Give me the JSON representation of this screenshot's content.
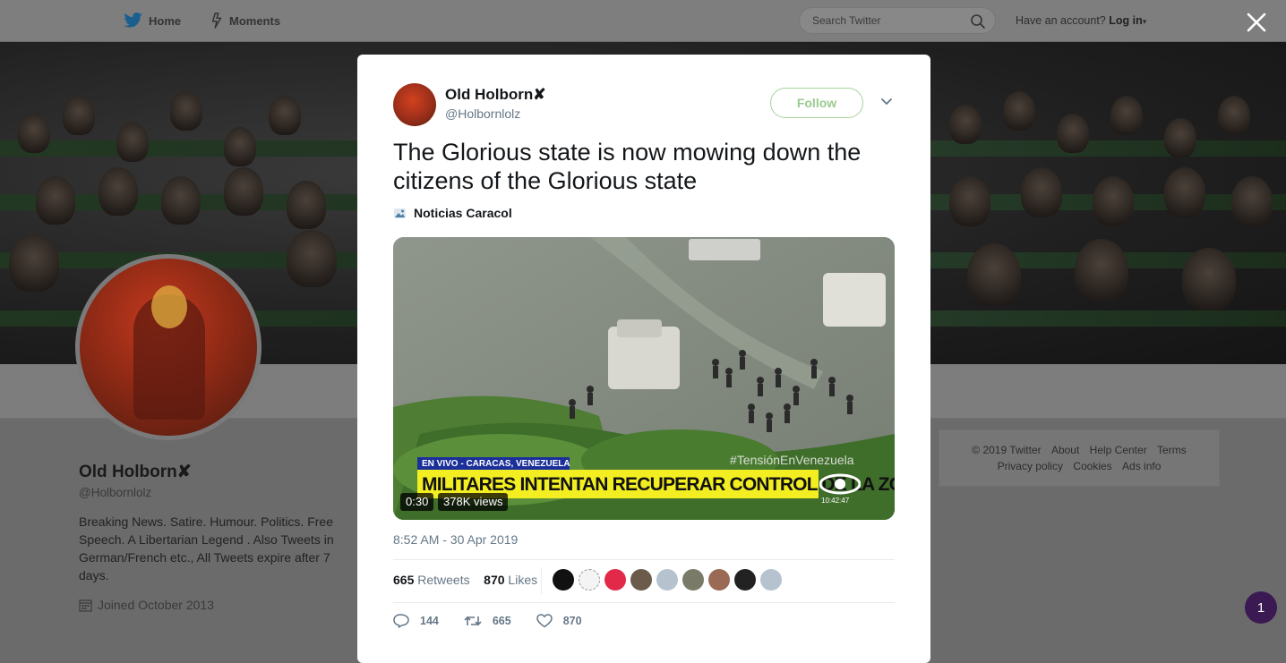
{
  "nav": {
    "home_label": "Home",
    "moments_label": "Moments",
    "search_placeholder": "Search Twitter",
    "account_prompt": "Have an account?",
    "login_label": "Log in"
  },
  "profile": {
    "name": "Old Holborn✘",
    "handle": "@Holbornlolz",
    "bio": "Breaking News. Satire. Humour. Politics. Free Speech. A Libertarian Legend . Also Tweets in German/French etc., All Tweets expire after 7 days.",
    "joined": "Joined October 2013"
  },
  "footer": {
    "links": [
      "© 2019 Twitter",
      "About",
      "Help Center",
      "Terms",
      "Privacy policy",
      "Cookies",
      "Ads info"
    ]
  },
  "notification_count": "1",
  "tweet": {
    "author_name": "Old Holborn✘",
    "author_handle": "@Holbornlolz",
    "follow_label": "Follow",
    "text": "The Glorious state is now mowing down the citizens of the Glorious state",
    "source_name": "Noticias Caracol",
    "video": {
      "banner_top": "EN VIVO - CARACAS, VENEZUELA",
      "banner_main": "MILITARES INTENTAN RECUPERAR CONTROL DE LA ZONA",
      "hashtag": "#TensiónEnVenezuela",
      "clock": "10:42:47",
      "duration": "0:30",
      "views": "378K views"
    },
    "timestamp": "8:52 AM - 30 Apr 2019",
    "retweets_count": "665",
    "retweets_label": "Retweets",
    "likes_count": "870",
    "likes_label": "Likes",
    "reply_count": "144",
    "retweet_action_count": "665",
    "like_action_count": "870"
  },
  "colors": {
    "brand": "#1da1f2",
    "follow_border": "#a7d29d",
    "badge": "#3b1a53",
    "video_banner_yellow": "#f2ee22",
    "video_banner_blue": "#1b2f9a"
  }
}
